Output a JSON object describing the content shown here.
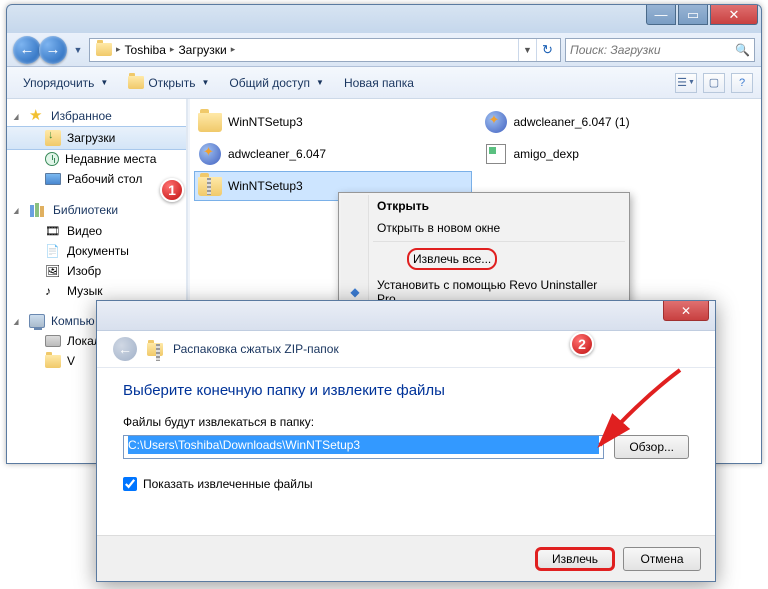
{
  "explorer": {
    "breadcrumb": {
      "seg1": "Toshiba",
      "seg2": "Загрузки"
    },
    "search_placeholder": "Поиск: Загрузки",
    "toolbar": {
      "organize": "Упорядочить",
      "open": "Открыть",
      "share": "Общий доступ",
      "newfolder": "Новая папка"
    },
    "sidebar": {
      "favorites": "Избранное",
      "downloads": "Загрузки",
      "recent": "Недавние места",
      "desktop": "Рабочий стол",
      "libraries": "Библиотеки",
      "video": "Видео",
      "documents": "Документы",
      "pictures": "Изобр",
      "music": "Музык",
      "computer": "Компью",
      "localdisk": "Локал",
      "drive_v": "V"
    },
    "files": {
      "f1": "WinNTSetup3",
      "f2": "adwcleaner_6.047 (1)",
      "f3": "adwcleaner_6.047",
      "f4": "amigo_dexp",
      "f5": "WinNTSetup3"
    }
  },
  "context_menu": {
    "open": "Открыть",
    "open_new": "Открыть в новом окне",
    "extract_all": "Извлечь все...",
    "revo": "Установить с помощью Revo Uninstaller Pro"
  },
  "dialog": {
    "title": "Распаковка сжатых ZIP-папок",
    "heading": "Выберите конечную папку и извлеките файлы",
    "label": "Файлы будут извлекаться в папку:",
    "path": "C:\\Users\\Toshiba\\Downloads\\WinNTSetup3",
    "browse": "Обзор...",
    "show_extracted": "Показать извлеченные файлы",
    "extract": "Извлечь",
    "cancel": "Отмена"
  },
  "badges": {
    "one": "1",
    "two": "2"
  }
}
